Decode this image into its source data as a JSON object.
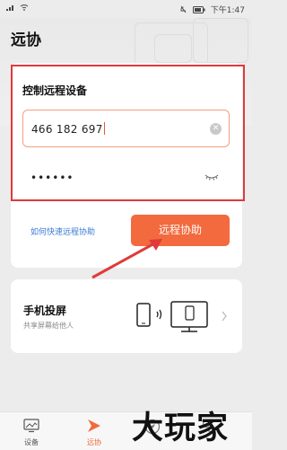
{
  "status_bar": {
    "time": "下午1:47"
  },
  "header": {
    "title": "远协"
  },
  "control_card": {
    "title": "控制远程设备",
    "device_id": "466 182 697",
    "password_masked": "••••••",
    "quick_link": "如何快速远程协助",
    "assist_button": "远程协助"
  },
  "projection_card": {
    "title": "手机投屏",
    "subtitle": "共享屏幕给他人"
  },
  "tab_bar": {
    "tabs": [
      {
        "label": "设备",
        "icon": "monitor-icon"
      },
      {
        "label": "远协",
        "icon": "remote-arrow-icon",
        "active": true
      },
      {
        "label": "",
        "icon": "compass-icon"
      },
      {
        "label": "",
        "icon": "user-icon"
      }
    ]
  },
  "watermark": {
    "text": "大玩家"
  },
  "colors": {
    "accent": "#f26a3d",
    "highlight_border": "#e03a3a",
    "link": "#3a7bd5"
  }
}
